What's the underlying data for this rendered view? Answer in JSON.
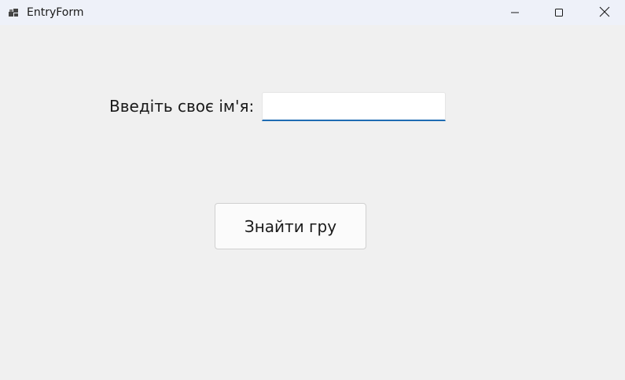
{
  "window": {
    "title": "EntryForm",
    "icon": "winforms-app-icon",
    "controls": {
      "minimize": "minimize-icon",
      "maximize": "maximize-icon",
      "close": "close-icon"
    }
  },
  "form": {
    "name_label": "Введіть своє ім'я:",
    "name_value": "",
    "find_button_label": "Знайти гру"
  },
  "colors": {
    "titlebar": "#eef1f9",
    "background": "#f0f0f0",
    "input_accent": "#1f6cb3"
  }
}
